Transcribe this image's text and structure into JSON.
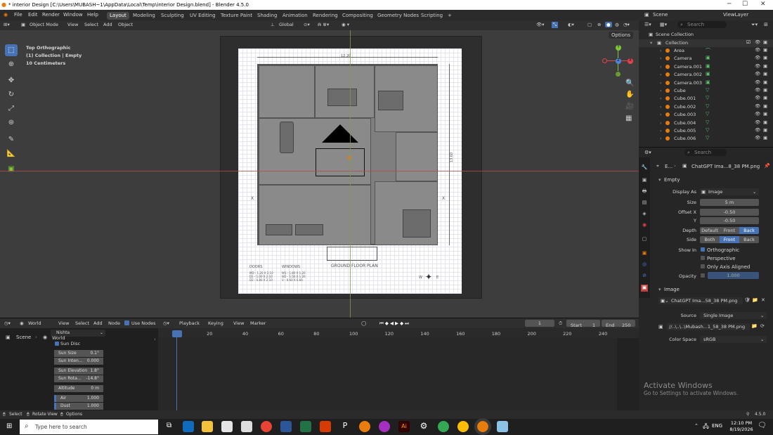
{
  "title_bar": {
    "title": "* interior Design [C:\\Users\\MUBASH~1\\AppData\\Local\\Temp\\interior Design.blend] - Blender 4.5.0",
    "minimize": "─",
    "maximize": "☐",
    "close": "✕"
  },
  "menu": {
    "file": "File",
    "edit": "Edit",
    "render": "Render",
    "window": "Window",
    "help": "Help"
  },
  "workspaces": [
    "Layout",
    "Modeling",
    "Sculpting",
    "UV Editing",
    "Texture Paint",
    "Shading",
    "Animation",
    "Rendering",
    "Compositing",
    "Geometry Nodes",
    "Scripting",
    "+"
  ],
  "top_right": {
    "scene": "Scene",
    "view_layer": "ViewLayer"
  },
  "viewport_header": {
    "mode": "Object Mode",
    "view": "View",
    "select": "Select",
    "add": "Add",
    "object": "Object",
    "orientation": "Global",
    "options": "Options"
  },
  "viewport_info": {
    "line1": "Top Orthographic",
    "line2": "(1) Collection | Empty",
    "line3": "10 Centimeters"
  },
  "plan": {
    "dim_top": "12.20",
    "dim_side": "13.60",
    "label": "GROUND FLOOR PLAN",
    "doors_title": "DOORS",
    "windows_title": "WINDOWS",
    "doors": [
      "MD - 1.20 X 2.10",
      "D1 - 1.00 X 2.10",
      "D2 - 0.80 X 2.10"
    ],
    "windows": [
      "W1 - 1.80 X 1.20",
      "W2 - 1.50 X 1.20",
      "V - 0.60 X 0.60"
    ],
    "section_left": "X",
    "section_right": "X",
    "north_w": "W",
    "north_e": "E"
  },
  "gizmo": {
    "x": "X",
    "y": "Y",
    "z": "Z"
  },
  "outliner": {
    "search_placeholder": "Search",
    "scene_collection": "Scene Collection",
    "collection": "Collection",
    "items": [
      "Area",
      "Camera",
      "Camera.001",
      "Camera.002",
      "Camera.003",
      "Cube",
      "Cube.001",
      "Cube.002",
      "Cube.003",
      "Cube.004",
      "Cube.005",
      "Cube.006"
    ]
  },
  "properties": {
    "search_placeholder": "Search",
    "breadcrumb_short": "E...",
    "breadcrumb": "ChatGPT Ima...8_38 PM.png",
    "empty_section": "Empty",
    "display_as_label": "Display As",
    "display_as": "Image",
    "size_label": "Size",
    "size": "5 m",
    "offset_x_label": "Offset X",
    "offset_x": "-0.50",
    "y_label": "Y",
    "offset_y": "-0.50",
    "depth_label": "Depth",
    "depth_default": "Default",
    "depth_front": "Front",
    "depth_back": "Back",
    "side_label": "Side",
    "side_both": "Both",
    "side_front": "Front",
    "side_back": "Back",
    "show_in_label": "Show In",
    "orthographic": "Orthographic",
    "perspective": "Perspective",
    "only_axis": "Only Axis Aligned",
    "opacity_label": "Opacity",
    "opacity": "1.000",
    "image_section": "Image",
    "image_name": "ChatGPT Ima...58_38 PM.png",
    "source_label": "Source",
    "source": "Single Image",
    "filepath": "//..\\..\\..\\Mubash...1_58_38 PM.png",
    "color_space_label": "Color Space",
    "color_space": "sRGB"
  },
  "timeline_header": {
    "world": "World",
    "view": "View",
    "select": "Select",
    "add": "Add",
    "node": "Node",
    "use_nodes": "Use Nodes",
    "playback": "Playback",
    "keying": "Keying",
    "view2": "View",
    "marker": "Marker",
    "current": "1",
    "start_label": "Start",
    "start": "1",
    "end_label": "End",
    "end": "250"
  },
  "timeline_ticks": [
    "1",
    "20",
    "40",
    "60",
    "80",
    "100",
    "120",
    "140",
    "160",
    "180",
    "200",
    "220",
    "240"
  ],
  "node_panel": {
    "scene": "Scene",
    "world_sel": "Nishta",
    "world": "World",
    "sun_disc": "Sun Disc",
    "rows": [
      {
        "label": "Sun Size",
        "value": "0.1°"
      },
      {
        "label": "Sun Inten...",
        "value": "0.000"
      },
      {
        "label": "Sun Elevation",
        "value": "1.8°"
      },
      {
        "label": "Sun Rota...",
        "value": "-14.8°"
      },
      {
        "label": "Altitude",
        "value": "0 m"
      },
      {
        "label": "Air",
        "value": "1.000"
      },
      {
        "label": "Dust",
        "value": "1.000"
      }
    ]
  },
  "status": {
    "select": "Select",
    "rotate": "Rotate View",
    "options": "Options",
    "version": "4.5.0"
  },
  "watermark": {
    "line1": "Activate Windows",
    "line2": "Go to Settings to activate Windows."
  },
  "taskbar": {
    "search_placeholder": "Type here to search",
    "lang": "ENG",
    "time": "12:10 PM",
    "date": "8/19/2026"
  },
  "colors": {
    "accent": "#4772b3",
    "x_axis": "#e2424b",
    "y_axis": "#7ec53c",
    "z_axis": "#4d85d8"
  }
}
